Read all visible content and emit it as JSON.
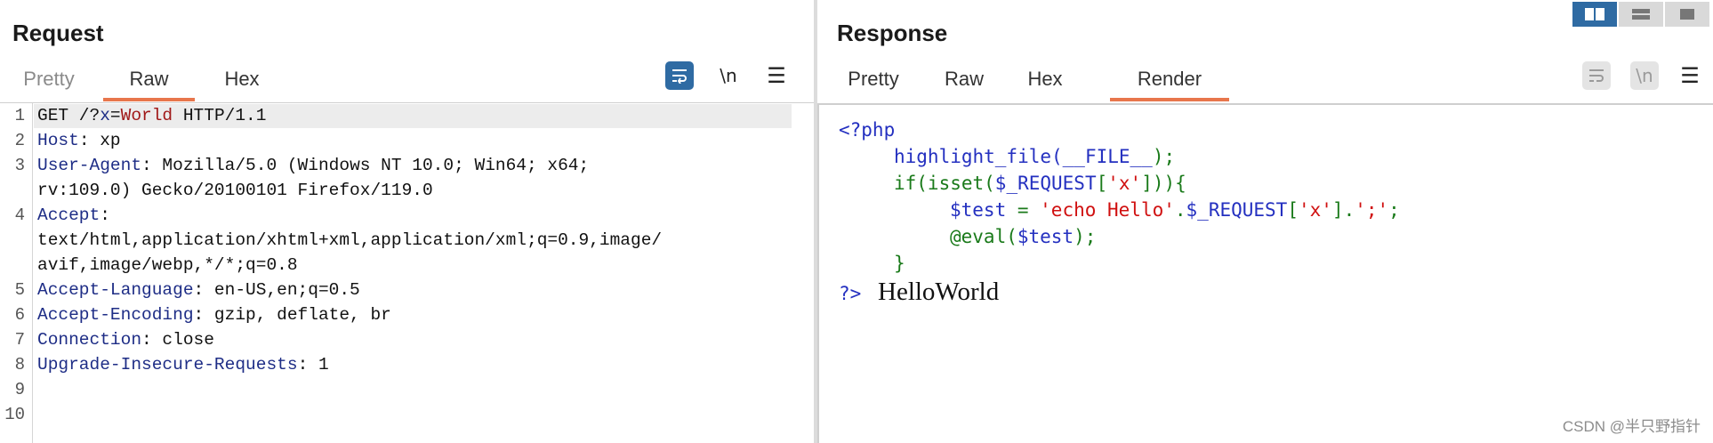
{
  "request": {
    "title": "Request",
    "tabs": [
      "Pretty",
      "Raw",
      "Hex"
    ],
    "active_tab": "Raw",
    "toolbar": {
      "wrap_icon": "wrap-lines-icon",
      "newline_label": "\\n",
      "menu_icon": "hamburger-icon"
    },
    "line_numbers": [
      "1",
      "2",
      "3",
      "4",
      "5",
      "6",
      "7",
      "8",
      "9",
      "10"
    ],
    "lines": {
      "l1": {
        "p1": "GET /?",
        "p2": "x",
        "p3": "=",
        "p4": "World",
        "p5": " HTTP/1.1"
      },
      "l2": {
        "k": "Host",
        "v": ": xp"
      },
      "l3": {
        "k": "User-Agent",
        "v": ": Mozilla/5.0 (Windows NT 10.0; Win64; x64;",
        "cont": "rv:109.0) Gecko/20100101 Firefox/119.0"
      },
      "l4": {
        "k": "Accept",
        "v": ":",
        "cont1": "text/html,application/xhtml+xml,application/xml;q=0.9,image/",
        "cont2": "avif,image/webp,*/*;q=0.8"
      },
      "l5": {
        "k": "Accept-Language",
        "v": ": en-US,en;q=0.5"
      },
      "l6": {
        "k": "Accept-Encoding",
        "v": ": gzip, deflate, br"
      },
      "l7": {
        "k": "Connection",
        "v": ": close"
      },
      "l8": {
        "k": "Upgrade-Insecure-Requests",
        "v": ": 1"
      }
    }
  },
  "response": {
    "title": "Response",
    "tabs": [
      "Pretty",
      "Raw",
      "Hex",
      "Render"
    ],
    "active_tab": "Render",
    "toolbar": {
      "wrap_icon": "wrap-lines-icon",
      "newline_label": "\\n",
      "menu_icon": "hamburger-icon"
    },
    "php": {
      "open": "<?php",
      "l2a": "highlight_file(",
      "l2b": "__FILE__",
      "l2c": ");",
      "l3a": "if(isset(",
      "l3b": "$_REQUEST",
      "l3c": "[",
      "l3d": "'x'",
      "l3e": "]))",
      "l3f": "{",
      "l4a": "$test ",
      "l4b": "= ",
      "l4c": "'echo Hello'",
      "l4d": ".",
      "l4e": "$_REQUEST",
      "l4f": "[",
      "l4g": "'x'",
      "l4h": "]",
      "l4i": ".",
      "l4j": "';'",
      "l4k": ";",
      "l5a": "@eval(",
      "l5b": "$test",
      "l5c": ");",
      "close_brace": "}",
      "close": "?>"
    },
    "output": "HelloWorld"
  },
  "layout_buttons": [
    "split-view-icon",
    "stacked-view-icon",
    "single-view-icon"
  ],
  "watermark": "CSDN @半只野指针",
  "colors": {
    "accent_tab": "#e8764c",
    "button_blue": "#2f6ba3",
    "php_blue": "#2430c0",
    "php_green": "#1a7a1a",
    "php_red": "#d01010",
    "php_orange": "#e07000",
    "header_key": "#1e2d86",
    "param_value": "#a01818"
  }
}
